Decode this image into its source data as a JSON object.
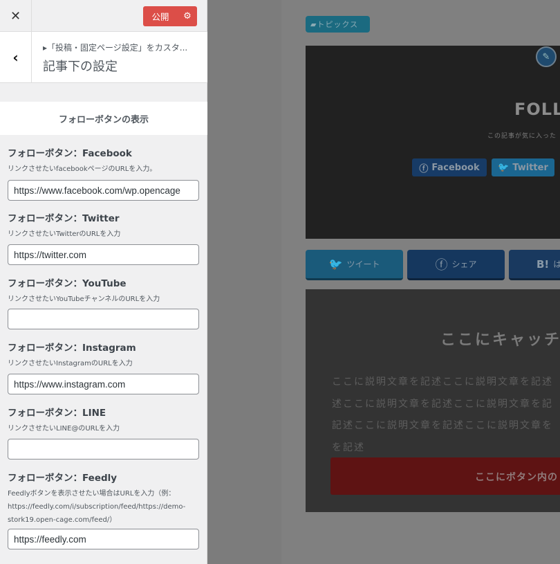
{
  "header": {
    "close_icon": "close-icon",
    "publish_label": "公開",
    "settings_icon": "gear-icon",
    "publish_color": "#dc4e48"
  },
  "section": {
    "back_icon": "chevron-left-icon",
    "breadcrumb": "▸「投稿・固定ページ設定」をカスタ...",
    "title": "記事下の設定"
  },
  "group": {
    "title": "フォローボタンの表示"
  },
  "fields": [
    {
      "label": "フォローボタン：Facebook",
      "desc": "リンクさせたいfacebookページのURLを入力。",
      "value": "https://www.facebook.com/wp.opencage"
    },
    {
      "label": "フォローボタン：Twitter",
      "desc": "リンクさせたいTwitterのURLを入力",
      "value": "https://twitter.com"
    },
    {
      "label": "フォローボタン：YouTube",
      "desc": "リンクさせたいYouTubeチャンネルのURLを入力",
      "value": ""
    },
    {
      "label": "フォローボタン：Instagram",
      "desc": "リンクさせたいInstagramのURLを入力",
      "value": "https://www.instagram.com"
    },
    {
      "label": "フォローボタン：LINE",
      "desc": "リンクさせたいLINE@のURLを入力",
      "value": ""
    },
    {
      "label": "フォローボタン：Feedly",
      "desc": "Feedlyボタンを表示させたい場合はURLを入力（例：https://feedly.com/i/subscription/feed/https://demo-stork19.open-cage.com/feed/）",
      "value": "https://feedly.com"
    }
  ],
  "preview": {
    "category": "トピックス",
    "follow_title": "FOLL",
    "follow_sub": "この記事が気に入った",
    "follow_buttons": [
      {
        "label": "Facebook",
        "icon": "facebook-icon"
      },
      {
        "label": "Twitter",
        "icon": "twitter-icon"
      }
    ],
    "share_buttons": [
      {
        "label": "ツイート",
        "icon": "twitter-icon"
      },
      {
        "label": "シェア",
        "icon": "facebook-icon"
      },
      {
        "label": "は",
        "icon": "hatena-icon",
        "icon_text": "B!"
      }
    ],
    "cta_title": "ここにキャッチ",
    "cta_lines": [
      "ここに説明文章を記述ここに説明文章を記述",
      "述ここに説明文章を記述ここに説明文章を記",
      "記述ここに説明文章を記述ここに説明文章を",
      "を記述"
    ],
    "cta_button": "ここにボタン内の"
  }
}
